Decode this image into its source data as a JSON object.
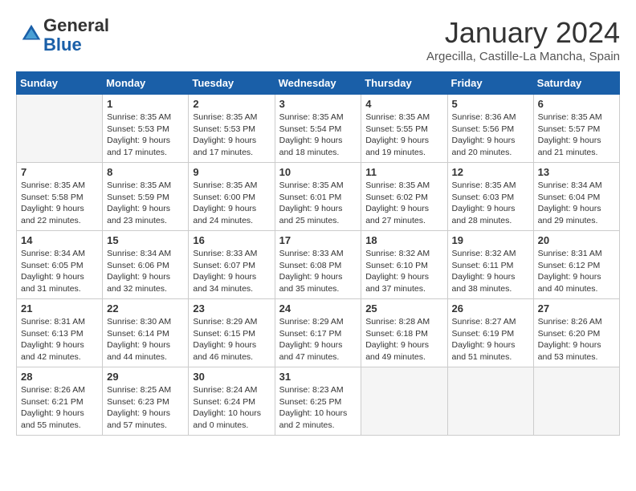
{
  "logo": {
    "general": "General",
    "blue": "Blue"
  },
  "header": {
    "month": "January 2024",
    "location": "Argecilla, Castille-La Mancha, Spain"
  },
  "weekdays": [
    "Sunday",
    "Monday",
    "Tuesday",
    "Wednesday",
    "Thursday",
    "Friday",
    "Saturday"
  ],
  "weeks": [
    [
      {
        "day": "",
        "empty": true
      },
      {
        "day": "1",
        "sunrise": "8:35 AM",
        "sunset": "5:53 PM",
        "daylight": "9 hours and 17 minutes."
      },
      {
        "day": "2",
        "sunrise": "8:35 AM",
        "sunset": "5:53 PM",
        "daylight": "9 hours and 17 minutes."
      },
      {
        "day": "3",
        "sunrise": "8:35 AM",
        "sunset": "5:54 PM",
        "daylight": "9 hours and 18 minutes."
      },
      {
        "day": "4",
        "sunrise": "8:35 AM",
        "sunset": "5:55 PM",
        "daylight": "9 hours and 19 minutes."
      },
      {
        "day": "5",
        "sunrise": "8:36 AM",
        "sunset": "5:56 PM",
        "daylight": "9 hours and 20 minutes."
      },
      {
        "day": "6",
        "sunrise": "8:35 AM",
        "sunset": "5:57 PM",
        "daylight": "9 hours and 21 minutes."
      }
    ],
    [
      {
        "day": "7",
        "sunrise": "8:35 AM",
        "sunset": "5:58 PM",
        "daylight": "9 hours and 22 minutes."
      },
      {
        "day": "8",
        "sunrise": "8:35 AM",
        "sunset": "5:59 PM",
        "daylight": "9 hours and 23 minutes."
      },
      {
        "day": "9",
        "sunrise": "8:35 AM",
        "sunset": "6:00 PM",
        "daylight": "9 hours and 24 minutes."
      },
      {
        "day": "10",
        "sunrise": "8:35 AM",
        "sunset": "6:01 PM",
        "daylight": "9 hours and 25 minutes."
      },
      {
        "day": "11",
        "sunrise": "8:35 AM",
        "sunset": "6:02 PM",
        "daylight": "9 hours and 27 minutes."
      },
      {
        "day": "12",
        "sunrise": "8:35 AM",
        "sunset": "6:03 PM",
        "daylight": "9 hours and 28 minutes."
      },
      {
        "day": "13",
        "sunrise": "8:34 AM",
        "sunset": "6:04 PM",
        "daylight": "9 hours and 29 minutes."
      }
    ],
    [
      {
        "day": "14",
        "sunrise": "8:34 AM",
        "sunset": "6:05 PM",
        "daylight": "9 hours and 31 minutes."
      },
      {
        "day": "15",
        "sunrise": "8:34 AM",
        "sunset": "6:06 PM",
        "daylight": "9 hours and 32 minutes."
      },
      {
        "day": "16",
        "sunrise": "8:33 AM",
        "sunset": "6:07 PM",
        "daylight": "9 hours and 34 minutes."
      },
      {
        "day": "17",
        "sunrise": "8:33 AM",
        "sunset": "6:08 PM",
        "daylight": "9 hours and 35 minutes."
      },
      {
        "day": "18",
        "sunrise": "8:32 AM",
        "sunset": "6:10 PM",
        "daylight": "9 hours and 37 minutes."
      },
      {
        "day": "19",
        "sunrise": "8:32 AM",
        "sunset": "6:11 PM",
        "daylight": "9 hours and 38 minutes."
      },
      {
        "day": "20",
        "sunrise": "8:31 AM",
        "sunset": "6:12 PM",
        "daylight": "9 hours and 40 minutes."
      }
    ],
    [
      {
        "day": "21",
        "sunrise": "8:31 AM",
        "sunset": "6:13 PM",
        "daylight": "9 hours and 42 minutes."
      },
      {
        "day": "22",
        "sunrise": "8:30 AM",
        "sunset": "6:14 PM",
        "daylight": "9 hours and 44 minutes."
      },
      {
        "day": "23",
        "sunrise": "8:29 AM",
        "sunset": "6:15 PM",
        "daylight": "9 hours and 46 minutes."
      },
      {
        "day": "24",
        "sunrise": "8:29 AM",
        "sunset": "6:17 PM",
        "daylight": "9 hours and 47 minutes."
      },
      {
        "day": "25",
        "sunrise": "8:28 AM",
        "sunset": "6:18 PM",
        "daylight": "9 hours and 49 minutes."
      },
      {
        "day": "26",
        "sunrise": "8:27 AM",
        "sunset": "6:19 PM",
        "daylight": "9 hours and 51 minutes."
      },
      {
        "day": "27",
        "sunrise": "8:26 AM",
        "sunset": "6:20 PM",
        "daylight": "9 hours and 53 minutes."
      }
    ],
    [
      {
        "day": "28",
        "sunrise": "8:26 AM",
        "sunset": "6:21 PM",
        "daylight": "9 hours and 55 minutes."
      },
      {
        "day": "29",
        "sunrise": "8:25 AM",
        "sunset": "6:23 PM",
        "daylight": "9 hours and 57 minutes."
      },
      {
        "day": "30",
        "sunrise": "8:24 AM",
        "sunset": "6:24 PM",
        "daylight": "10 hours and 0 minutes."
      },
      {
        "day": "31",
        "sunrise": "8:23 AM",
        "sunset": "6:25 PM",
        "daylight": "10 hours and 2 minutes."
      },
      {
        "day": "",
        "empty": true
      },
      {
        "day": "",
        "empty": true
      },
      {
        "day": "",
        "empty": true
      }
    ]
  ]
}
